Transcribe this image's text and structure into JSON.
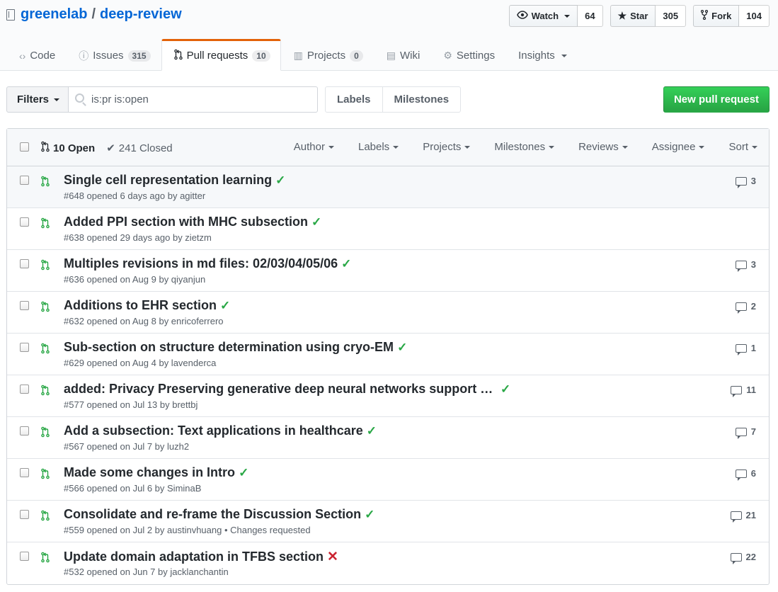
{
  "repo": {
    "owner": "greenelab",
    "separator": "/",
    "name": "deep-review"
  },
  "actions": {
    "watch": {
      "label": "Watch",
      "count": "64"
    },
    "star": {
      "label": "Star",
      "count": "305"
    },
    "fork": {
      "label": "Fork",
      "count": "104"
    }
  },
  "nav": [
    {
      "icon": "‹›",
      "label": "Code",
      "count": ""
    },
    {
      "icon": "ⓘ",
      "label": "Issues",
      "count": "315"
    },
    {
      "icon": "",
      "label": "Pull requests",
      "count": "10"
    },
    {
      "icon": "▥",
      "label": "Projects",
      "count": "0"
    },
    {
      "icon": "▤",
      "label": "Wiki",
      "count": ""
    },
    {
      "icon": "⚙",
      "label": "Settings",
      "count": ""
    },
    {
      "icon": "",
      "label": "Insights",
      "count": ""
    }
  ],
  "subnav": {
    "filters": "Filters",
    "search_value": "is:pr is:open",
    "labels": "Labels",
    "milestones": "Milestones",
    "new_pr": "New pull request"
  },
  "list_header": {
    "open": "10 Open",
    "closed": "241 Closed",
    "filters": [
      "Author",
      "Labels",
      "Projects",
      "Milestones",
      "Reviews",
      "Assignee",
      "Sort"
    ]
  },
  "pulls": [
    {
      "title": "Single cell representation learning",
      "status": "success",
      "meta": "#648 opened 6 days ago by agitter",
      "comments": "3"
    },
    {
      "title": "Added PPI section with MHC subsection",
      "status": "success",
      "meta": "#638 opened 29 days ago by zietzm",
      "comments": ""
    },
    {
      "title": "Multiples revisions in md files: 02/03/04/05/06",
      "status": "success",
      "meta": "#636 opened on Aug 9 by qiyanjun",
      "comments": "3"
    },
    {
      "title": "Additions to EHR section",
      "status": "success",
      "meta": "#632 opened on Aug 8 by enricoferrero",
      "comments": "2"
    },
    {
      "title": "Sub-section on structure determination using cryo-EM",
      "status": "success",
      "meta": "#629 opened on Aug 4 by lavenderca",
      "comments": "1"
    },
    {
      "title": "added: Privacy Preserving generative deep neural networks support cli…",
      "status": "success",
      "meta": "#577 opened on Jul 13 by brettbj",
      "comments": "11"
    },
    {
      "title": "Add a subsection: Text applications in healthcare",
      "status": "success",
      "meta": "#567 opened on Jul 7 by luzh2",
      "comments": "7"
    },
    {
      "title": "Made some changes in Intro",
      "status": "success",
      "meta": "#566 opened on Jul 6 by SiminaB",
      "comments": "6"
    },
    {
      "title": "Consolidate and re-frame the Discussion Section",
      "status": "success",
      "meta": "#559 opened on Jul 2 by austinvhuang • Changes requested",
      "comments": "21"
    },
    {
      "title": "Update domain adaptation in TFBS section",
      "status": "failure",
      "meta": "#532 opened on Jun 7 by jacklanchantin",
      "comments": "22"
    }
  ],
  "colors": {
    "accent": "#e36209",
    "green": "#28a745",
    "link": "#0366d6",
    "fail": "#cb2431"
  }
}
